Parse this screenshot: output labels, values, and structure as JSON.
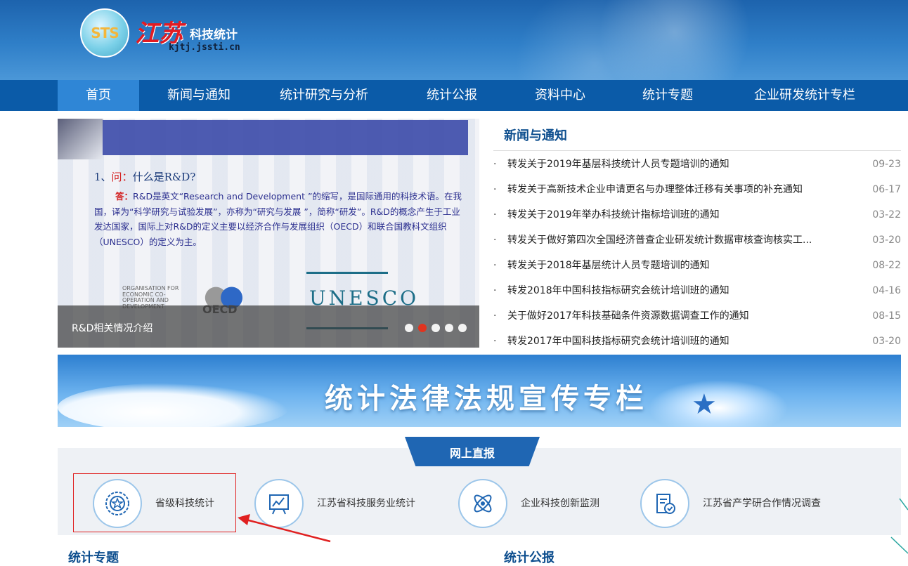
{
  "header": {
    "logo_mark": "STS",
    "logo_region": "江苏",
    "logo_title": "科技统计",
    "logo_url": "kjtj.jssti.cn"
  },
  "nav": {
    "items": [
      {
        "label": "首页",
        "active": true
      },
      {
        "label": "新闻与通知",
        "active": false
      },
      {
        "label": "统计研究与分析",
        "active": false
      },
      {
        "label": "统计公报",
        "active": false
      },
      {
        "label": "资料中心",
        "active": false
      },
      {
        "label": "统计专题",
        "active": false
      },
      {
        "label": "企业研发统计专栏",
        "active": false
      }
    ]
  },
  "slider": {
    "question_num": "1、",
    "question_prefix": "问：",
    "question_text": "什么是R&D?",
    "answer_prefix": "答：",
    "answer_text": "R&D是英文“Research and Development ”的缩写，是国际通用的科技术语。在我国，译为“科学研究与试验发展”，亦称为“研究与发展 ”，简称“研发”。R&D的概念产生于工业发达国家，国际上对R&D的定义主要以经济合作与发展组织（OECD）和联合国教科文组织（UNESCO）的定义为主。",
    "oecd_text": "ORGANISATION FOR ECONOMIC CO-OPERATION AND DEVELOPMENT",
    "oecd_mark": "OECD",
    "unesco_mark": "UNESCO",
    "caption": "R&D相关情况介绍",
    "slide_count": 5,
    "active_slide": 2
  },
  "news": {
    "title": "新闻与通知",
    "items": [
      {
        "title": "转发关于2019年基层科技统计人员专题培训的通知",
        "date": "09-23"
      },
      {
        "title": "转发关于高新技术企业申请更名与办理整体迁移有关事项的补充通知",
        "date": "06-17"
      },
      {
        "title": "转发关于2019年举办科技统计指标培训班的通知",
        "date": "03-22"
      },
      {
        "title": "转发关于做好第四次全国经济普查企业研发统计数据审核查询核实工...",
        "date": "03-20"
      },
      {
        "title": "转发关于2018年基层统计人员专题培训的通知",
        "date": "08-22"
      },
      {
        "title": "转发2018年中国科技指标研究会统计培训班的通知",
        "date": "04-16"
      },
      {
        "title": "关于做好2017年科技基础条件资源数据调查工作的通知",
        "date": "08-15"
      },
      {
        "title": "转发2017年中国科技指标研究会统计培训班的通知",
        "date": "03-20"
      }
    ]
  },
  "banner": {
    "text": "统计法律法规宣传专栏"
  },
  "report": {
    "tab": "网上直报",
    "items": [
      {
        "label": "省级科技统计",
        "icon": "badge-star-icon"
      },
      {
        "label": "江苏省科技服务业统计",
        "icon": "chart-board-icon"
      },
      {
        "label": "企业科技创新监测",
        "icon": "atom-icon"
      },
      {
        "label": "江苏省产学研合作情况调查",
        "icon": "clipboard-check-icon"
      }
    ]
  },
  "sections": {
    "left_title": "统计专题",
    "right_title": "统计公报"
  },
  "colors": {
    "brand_blue": "#0b5ba8",
    "nav_active": "#2f86d6",
    "highlight_red": "#e02020"
  }
}
